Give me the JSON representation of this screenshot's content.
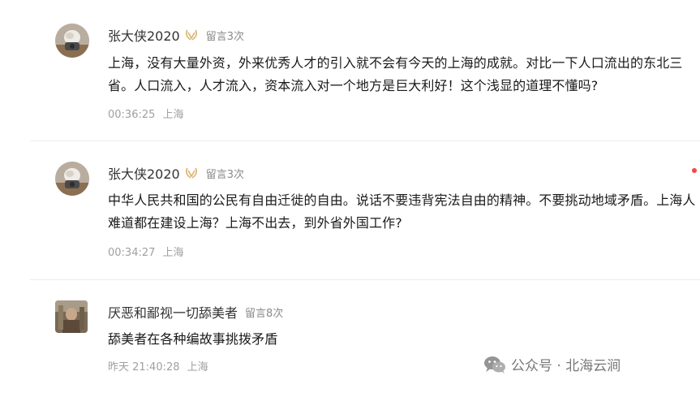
{
  "comments": [
    {
      "name": "张大侠2020",
      "count_label": "留言3次",
      "text": "上海，没有大量外资，外来优秀人才的引入就不会有今天的上海的成就。对比一下人口流出的东北三省。人口流入，人才流入，资本流入对一个地方是巨大利好！这个浅显的道理不懂吗?",
      "time": "00:36:25",
      "location": "上海"
    },
    {
      "name": "张大侠2020",
      "count_label": "留言3次",
      "text": "中华人民共和国的公民有自由迁徙的自由。说话不要违背宪法自由的精神。不要挑动地域矛盾。上海人难道都在建设上海？上海不出去，到外省外国工作?",
      "time": "00:34:27",
      "location": "上海"
    },
    {
      "name": "厌恶和鄙视一切舔美者",
      "count_label": "留言8次",
      "text": "舔美者在各种编故事挑拨矛盾",
      "time": "昨天 21:40:28",
      "location": "上海"
    }
  ],
  "watermark": {
    "text": "公众号 · 北海云涧"
  },
  "icons": {
    "badge": "laurel-badge-icon",
    "watermark": "wechat-icon",
    "unread": "red-dot"
  },
  "colors": {
    "badge": "#d9b36a",
    "unread_dot": "#f04a48"
  }
}
